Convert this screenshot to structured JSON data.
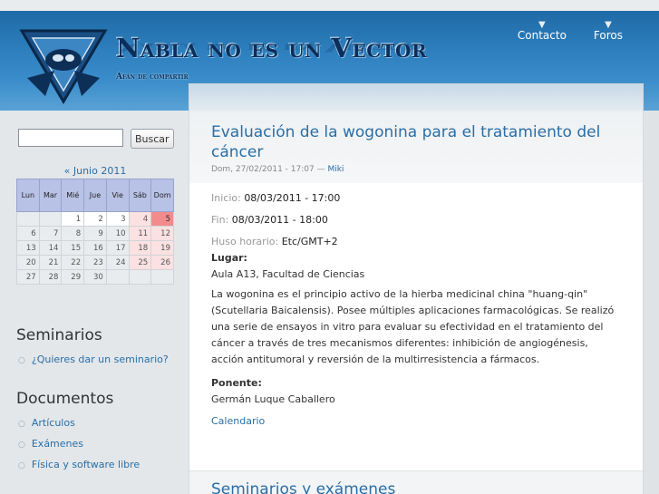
{
  "header": {
    "site_name": "Nabla no es un Vector",
    "slogan": "Afán de compartir",
    "nav": [
      {
        "label": "Contacto"
      },
      {
        "label": "Foros"
      }
    ],
    "colors": {
      "header_blue": "#2d7fbd",
      "title_navy": "#0b2f5c",
      "link": "#2a6ea6"
    }
  },
  "search": {
    "value": "",
    "button_label": "Buscar"
  },
  "calendar": {
    "caption": "« Junio 2011",
    "days": [
      "Lun",
      "Mar",
      "Mié",
      "Jue",
      "Vie",
      "Sáb",
      "Dom"
    ],
    "weeks": [
      [
        "",
        "",
        "1",
        "2",
        "3",
        "4",
        "5"
      ],
      [
        "6",
        "7",
        "8",
        "9",
        "10",
        "11",
        "12"
      ],
      [
        "13",
        "14",
        "15",
        "16",
        "17",
        "18",
        "19"
      ],
      [
        "20",
        "21",
        "22",
        "23",
        "24",
        "25",
        "26"
      ],
      [
        "27",
        "28",
        "29",
        "30",
        "",
        "",
        ""
      ]
    ],
    "today": "5",
    "colors": {
      "header": "#b8c2e6",
      "weekend": "#fbe1e1",
      "today": "#f28b8b"
    }
  },
  "sidebar": {
    "seminarios_title": "Seminarios",
    "seminarios_items": [
      "¿Quieres dar un seminario?"
    ],
    "documentos_title": "Documentos",
    "documentos_items": [
      "Artículos",
      "Exámenes",
      "Física y software libre"
    ]
  },
  "node": {
    "title": "Evaluación de la wogonina para el tratamiento del cáncer",
    "submitted_date": "Dom, 27/02/2011 - 17:07 —",
    "author": "Miki",
    "inicio_label": "Inicio:",
    "inicio_value": "08/03/2011 - 17:00",
    "fin_label": "Fin:",
    "fin_value": "08/03/2011 - 18:00",
    "tz_label": "Huso horario:",
    "tz_value": "Etc/GMT+2",
    "lugar_label": "Lugar:",
    "lugar_value": "Aula A13, Facultad de Ciencias",
    "description": "La wogonina es el principio activo de la hierba medicinal china \"huang-qin\" (Scutellaria Baicalensis). Posee múltiples aplicaciones farmacológicas. Se realizó una serie de ensayos in vitro para evaluar su efectividad en el tratamiento del cáncer a través de tres mecanismos diferentes: inhibición de angiogénesis, acción antitumoral y reversión de la multirresistencia a fármacos.",
    "ponente_label": "Ponente:",
    "ponente_value": "Germán Luque Caballero",
    "calendar_link": "Calendario"
  },
  "next_node": {
    "title": "Seminarios y exámenes"
  }
}
